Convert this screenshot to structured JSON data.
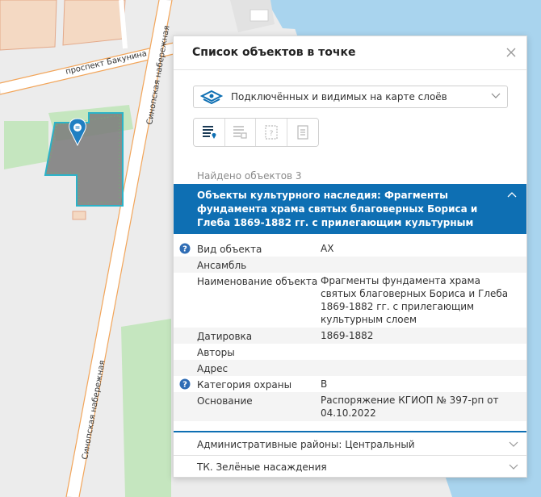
{
  "map": {
    "streets": {
      "bakunina": "проспект Бакунина",
      "sinopskaya_top": "Синопская набережная",
      "sinopskaya_bottom": "Синопская набережная"
    },
    "map_marker": {
      "icon": "pin-marker-icon",
      "color": "#1f7fc2"
    },
    "colors": {
      "water": "#a9d4ee",
      "park": "#c5e6bf",
      "object_fill": "#7a7a7a",
      "object_outline": "#2bb3c8"
    }
  },
  "panel": {
    "title": "Список объектов в точке",
    "layer_select": {
      "value": "Подключённых и видимых на карте слоёв"
    },
    "found_label": "Найдено объектов 3",
    "section": {
      "title": "Объекты культурного наследия: Фрагменты фундамента храма святых благоверных Бориса и Глеба 1869-1882 гг. с прилегающим культурным слоем"
    },
    "properties": [
      {
        "key": "Вид объекта",
        "value": "АХ",
        "info": true
      },
      {
        "key": "Ансамбль",
        "value": "",
        "info": false
      },
      {
        "key": "Наименование объекта",
        "value": "Фрагменты фундамента храма святых благоверных Бориса и Глеба 1869-1882 гг. с прилегающим культурным слоем",
        "info": false
      },
      {
        "key": "Датировка",
        "value": "1869-1882",
        "info": false
      },
      {
        "key": "Авторы",
        "value": "",
        "info": false
      },
      {
        "key": "Адрес",
        "value": "",
        "info": false
      },
      {
        "key": "Категория охраны",
        "value": "В",
        "info": true
      },
      {
        "key": "Основание",
        "value": "Распоряжение КГИОП № 397-рп от 04.10.2022",
        "info": false
      }
    ],
    "collapsed_sections": [
      {
        "label": "Административные районы: Центральный"
      },
      {
        "label": "ТК. Зелёные насаждения"
      }
    ],
    "accent_color": "#0e6fb3"
  }
}
